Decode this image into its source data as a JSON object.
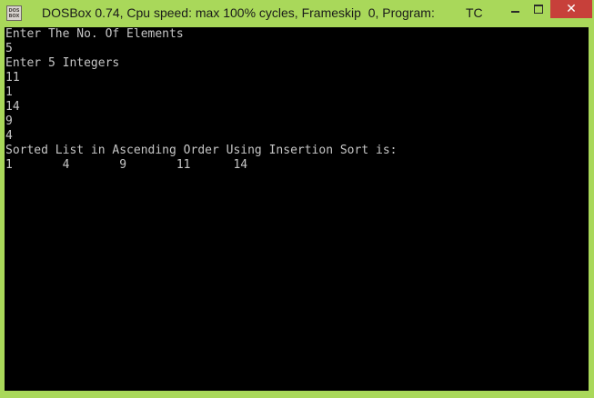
{
  "window": {
    "title": "DOSBox 0.74, Cpu speed: max 100% cycles, Frameskip  0, Program:",
    "program": "TC",
    "icon_label": "DOS BOX",
    "controls": {
      "minimize": "minimize-icon",
      "maximize": "maximize-icon",
      "close": "close-icon",
      "close_glyph": "✕"
    },
    "colors": {
      "frame": "#a9d85a",
      "close_button": "#c7403a",
      "console_bg": "#000000",
      "console_text": "#c6c6c6"
    }
  },
  "console": {
    "lines": [
      "Enter The No. Of Elements",
      "5",
      "Enter 5 Integers",
      "11",
      "1",
      "14",
      "9",
      "4",
      "Sorted List in Ascending Order Using Insertion Sort is:",
      "1       4       9       11      14"
    ]
  }
}
